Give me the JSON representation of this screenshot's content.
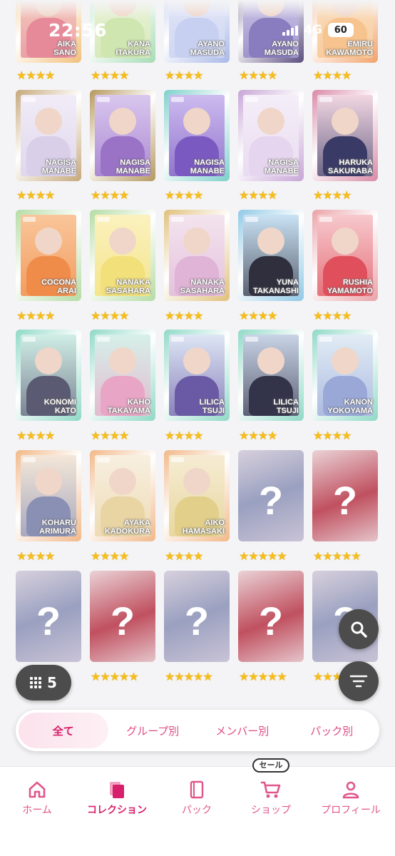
{
  "status_bar": {
    "time": "22:56",
    "network": "4G",
    "battery": "60"
  },
  "cards": [
    {
      "name": [
        "AIKA",
        "SANO"
      ],
      "stars": "★★★★",
      "colors": [
        "#f1c07a",
        "#e68a9a",
        "#f7d7c4"
      ]
    },
    {
      "name": [
        "KANA",
        "ITAKURA"
      ],
      "stars": "★★★★",
      "colors": [
        "#a6dcb4",
        "#cfe6b0",
        "#eef4dd"
      ]
    },
    {
      "name": [
        "AYANO",
        "MASUDA"
      ],
      "stars": "★★★★",
      "colors": [
        "#a8b8e8",
        "#c7d0f0",
        "#e6e9fa"
      ]
    },
    {
      "name": [
        "AYANO",
        "MASUDA"
      ],
      "stars": "★★★★",
      "colors": [
        "#5a4c7e",
        "#8a7dbf",
        "#d8d2ee"
      ]
    },
    {
      "name": [
        "EMIRU",
        "KAWAMOTO"
      ],
      "stars": "★★★★",
      "colors": [
        "#f2a26a",
        "#f7c38e",
        "#fae3c8"
      ]
    },
    {
      "name": [
        "NAGISA",
        "MANABE"
      ],
      "stars": "★★★★",
      "colors": [
        "#c6a87a",
        "#d9cfe9",
        "#f1ecf7"
      ]
    },
    {
      "name": [
        "NAGISA",
        "MANABE"
      ],
      "stars": "★★★★",
      "colors": [
        "#b5985e",
        "#9a72c6",
        "#d9c7ee"
      ]
    },
    {
      "name": [
        "NAGISA",
        "MANABE"
      ],
      "stars": "★★★★",
      "colors": [
        "#7dd0cb",
        "#7a5ac0",
        "#cdbbef"
      ]
    },
    {
      "name": [
        "NAGISA",
        "MANABE"
      ],
      "stars": "★★★★",
      "colors": [
        "#c7a5d6",
        "#e6d5ee",
        "#f4eef8"
      ]
    },
    {
      "name": [
        "HARUKA",
        "SAKURABA"
      ],
      "stars": "★★★★",
      "colors": [
        "#d98aa6",
        "#3a3a66",
        "#f2d7e2"
      ]
    },
    {
      "name": [
        "COCONA",
        "ARAI"
      ],
      "stars": "★★★★",
      "colors": [
        "#b4dca4",
        "#f08c4a",
        "#f9c69a"
      ]
    },
    {
      "name": [
        "NANAKA",
        "SASAHARA"
      ],
      "stars": "★★★★",
      "colors": [
        "#b4dca4",
        "#f2e07a",
        "#fbf1be"
      ]
    },
    {
      "name": [
        "NANAKA",
        "SASAHARA"
      ],
      "stars": "★★★★",
      "colors": [
        "#e0c07a",
        "#dfb4d6",
        "#f3e4ee"
      ]
    },
    {
      "name": [
        "YUNA",
        "TAKANASHI"
      ],
      "stars": "★★★★",
      "colors": [
        "#90c9e6",
        "#2f2f3e",
        "#c9e2f4"
      ]
    },
    {
      "name": [
        "RUSHIA",
        "YAMAMOTO"
      ],
      "stars": "★★★★",
      "colors": [
        "#eaa2a8",
        "#e0505c",
        "#f6c9cd"
      ]
    },
    {
      "name": [
        "KONOMI",
        "KATO"
      ],
      "stars": "★★★★",
      "colors": [
        "#8fd9c6",
        "#5a5a72",
        "#d0eee6"
      ]
    },
    {
      "name": [
        "KAHO",
        "TAKAYAMA"
      ],
      "stars": "★★★★",
      "colors": [
        "#8fd9c6",
        "#e9a5c5",
        "#d6f0e9"
      ]
    },
    {
      "name": [
        "LILICA",
        "TSUJI"
      ],
      "stars": "★★★★",
      "colors": [
        "#8fd9c6",
        "#6a5aa6",
        "#dde6f4"
      ]
    },
    {
      "name": [
        "LILICA",
        "TSUJI"
      ],
      "stars": "★★★★",
      "colors": [
        "#8fd9c6",
        "#33334a",
        "#c9d4e6"
      ]
    },
    {
      "name": [
        "KANON",
        "YOKOYAMA"
      ],
      "stars": "★★★★",
      "colors": [
        "#8fd9c6",
        "#9aa8d8",
        "#e1ecf5"
      ]
    },
    {
      "name": [
        "KOHARU",
        "ARIMURA"
      ],
      "stars": "★★★★",
      "colors": [
        "#f2b888",
        "#8a90b4",
        "#f4e7d8"
      ]
    },
    {
      "name": [
        "AYAKA",
        "KADOKURA"
      ],
      "stars": "★★★★",
      "colors": [
        "#f2b888",
        "#e9d4a4",
        "#f8efe0"
      ]
    },
    {
      "name": [
        "AIKO",
        "HAMASAKI"
      ],
      "stars": "★★★★",
      "colors": [
        "#f2b888",
        "#e2cf8a",
        "#f6ecd4"
      ]
    },
    {
      "name": [
        "",
        ""
      ],
      "stars": "★★★★★",
      "unknown": "blue"
    },
    {
      "name": [
        "",
        ""
      ],
      "stars": "★★★★★",
      "unknown": "red"
    },
    {
      "name": [
        "",
        ""
      ],
      "stars": "★★★★★",
      "unknown": "blue"
    },
    {
      "name": [
        "",
        ""
      ],
      "stars": "★★★★★",
      "unknown": "red"
    },
    {
      "name": [
        "",
        ""
      ],
      "stars": "★★★★★",
      "unknown": "blue"
    },
    {
      "name": [
        "",
        ""
      ],
      "stars": "★★★★★",
      "unknown": "red"
    },
    {
      "name": [
        "",
        ""
      ],
      "stars": "★★★★★",
      "unknown": "blue"
    }
  ],
  "unknown_mark": "?",
  "columns_button": {
    "count": "5"
  },
  "filter_tabs": [
    {
      "label": "全て",
      "active": true
    },
    {
      "label": "グループ別",
      "active": false
    },
    {
      "label": "メンバー別",
      "active": false
    },
    {
      "label": "パック別",
      "active": false
    }
  ],
  "sale_badge": "セール",
  "bottom_nav": [
    {
      "label": "ホーム",
      "icon": "home-icon",
      "active": false
    },
    {
      "label": "コレクション",
      "icon": "collection-icon",
      "active": true
    },
    {
      "label": "パック",
      "icon": "pack-icon",
      "active": false
    },
    {
      "label": "ショップ",
      "icon": "cart-icon",
      "active": false
    },
    {
      "label": "プロフィール",
      "icon": "profile-icon",
      "active": false
    }
  ],
  "colors": {
    "accent": "#e0568b",
    "accent_active": "#d6206b",
    "fab": "#4c4c4c",
    "star": "#f5be1b"
  }
}
